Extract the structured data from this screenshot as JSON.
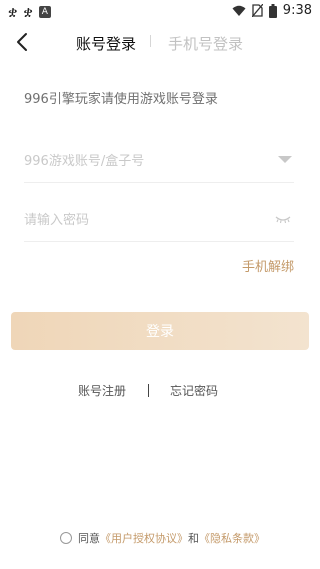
{
  "status_bar": {
    "left_glyph_1": "ቋ",
    "left_glyph_2": "ቋ",
    "badge": "A",
    "time": "9:38"
  },
  "header": {
    "tab_account": "账号登录",
    "tab_phone": "手机号登录"
  },
  "hint": "996引擎玩家请使用游戏账号登录",
  "form": {
    "account_placeholder": "996游戏账号/盒子号",
    "password_placeholder": "请输入密码",
    "phone_unbind": "手机解绑",
    "login_label": "登录"
  },
  "links": {
    "register": "账号注册",
    "separator": "|",
    "forgot": "忘记密码"
  },
  "agreement": {
    "prefix": "同意",
    "user_agreement": "《用户授权协议》",
    "and": "和",
    "privacy": "《隐私条款》"
  },
  "colors": {
    "accent": "#c49a6a",
    "button_start": "#efd6b8",
    "button_end": "#f3e3cf"
  },
  "icons": [
    "back-arrow-icon",
    "dropdown-arrow-icon",
    "eye-closed-icon",
    "wifi-icon",
    "no-sim-icon",
    "battery-icon"
  ]
}
